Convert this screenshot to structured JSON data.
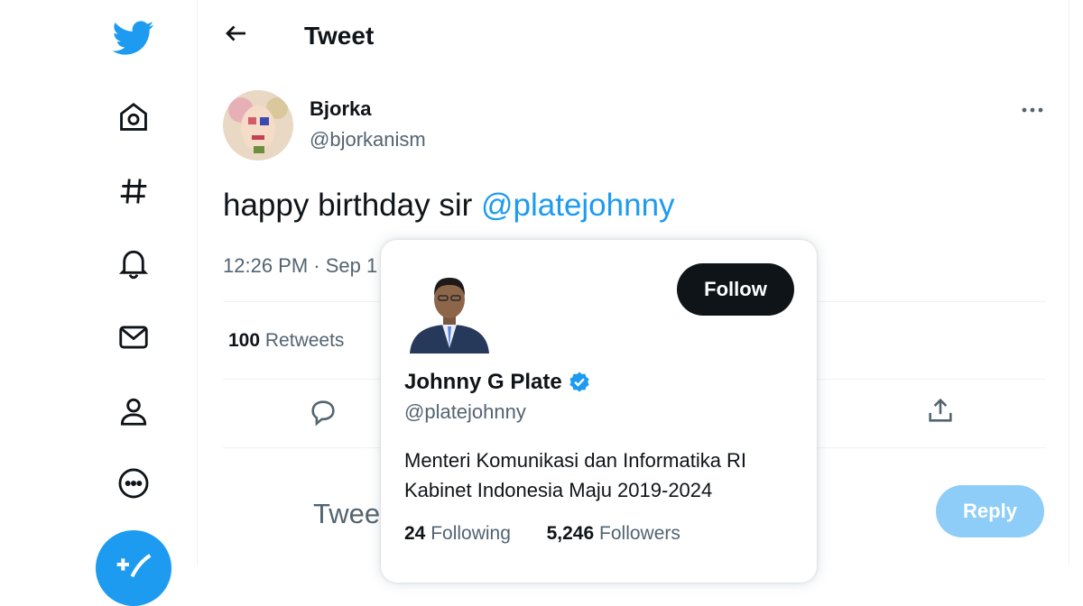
{
  "header": {
    "title": "Tweet"
  },
  "sidebar": {
    "icons": [
      "twitter-logo-icon",
      "home-icon",
      "explore-hashtag-icon",
      "notifications-bell-icon",
      "messages-envelope-icon",
      "profile-person-icon",
      "more-circle-icon",
      "compose-tweet-icon"
    ]
  },
  "tweet": {
    "author_name": "Bjorka",
    "author_handle": "@bjorkanism",
    "text_prefix": "happy birthday sir ",
    "mention": "@platejohnny",
    "timestamp": "12:26 PM · Sep 1",
    "retweets_count": "100",
    "retweets_label": "Retweets"
  },
  "reply": {
    "placeholder": "Twee",
    "button_label": "Reply"
  },
  "hover_card": {
    "name": "Johnny G Plate",
    "handle": "@platejohnny",
    "follow_label": "Follow",
    "bio_line1": "Menteri Komunikasi dan Informatika RI",
    "bio_line2": "Kabinet Indonesia Maju 2019-2024",
    "following_count": "24",
    "following_label": "Following",
    "followers_count": "5,246",
    "followers_label": "Followers"
  },
  "colors": {
    "accent": "#1d9bf0",
    "text": "#0f1419",
    "muted": "#536471",
    "reply_disabled": "#8ecdf7"
  }
}
